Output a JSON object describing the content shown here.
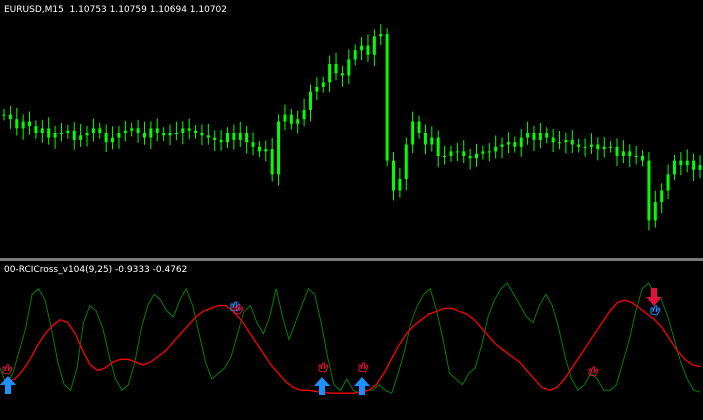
{
  "main_chart": {
    "label": "EURUSD,M15  1.10753 1.10759 1.10694 1.10702",
    "candle_color": "#00ff00"
  },
  "indicator": {
    "label": "00-RCICross_v104(9,25) -0.9333 -0.4762",
    "fast_color": "#008000",
    "slow_color": "#ff0000",
    "buy_arrow_color": "#1e90ff",
    "sell_arrow_color": "#dc143c",
    "hand_icon": "hand-signal-icon"
  },
  "chart_data": [
    {
      "type": "candlestick",
      "title": "EURUSD,M15  1.10753 1.10759 1.10694 1.10702",
      "series": [
        {
          "name": "EURUSD,M15",
          "values": [
            0.58,
            0.56,
            0.52,
            0.55,
            0.53,
            0.5,
            0.52,
            0.48,
            0.5,
            0.5,
            0.51,
            0.47,
            0.49,
            0.5,
            0.52,
            0.5,
            0.46,
            0.48,
            0.5,
            0.51,
            0.52,
            0.5,
            0.48,
            0.52,
            0.5,
            0.49,
            0.5,
            0.5,
            0.52,
            0.51,
            0.5,
            0.49,
            0.48,
            0.47,
            0.46,
            0.5,
            0.47,
            0.5,
            0.46,
            0.44,
            0.42,
            0.43,
            0.32,
            0.55,
            0.58,
            0.54,
            0.56,
            0.6,
            0.68,
            0.7,
            0.72,
            0.8,
            0.76,
            0.75,
            0.82,
            0.86,
            0.88,
            0.84,
            0.92,
            0.93,
            0.38,
            0.25,
            0.3,
            0.45,
            0.55,
            0.5,
            0.45,
            0.48,
            0.4,
            0.4,
            0.42,
            0.42,
            0.4,
            0.39,
            0.41,
            0.42,
            0.42,
            0.44,
            0.45,
            0.46,
            0.44,
            0.48,
            0.5,
            0.47,
            0.5,
            0.48,
            0.46,
            0.46,
            0.47,
            0.45,
            0.44,
            0.44,
            0.45,
            0.43,
            0.44,
            0.44,
            0.4,
            0.42,
            0.4,
            0.4,
            0.38,
            0.12,
            0.2,
            0.25,
            0.32,
            0.38,
            0.36,
            0.38,
            0.34,
            0.36
          ]
        }
      ]
    },
    {
      "type": "line",
      "title": "00-RCICross_v104(9,25) -0.9333 -0.4762",
      "series": [
        {
          "name": "RCI 9",
          "values": [
            -0.5,
            -0.8,
            -0.6,
            -0.2,
            0.2,
            0.8,
            0.9,
            0.7,
            0.2,
            -0.4,
            -0.8,
            -0.9,
            -0.5,
            0.3,
            0.6,
            0.5,
            0.2,
            -0.3,
            -0.7,
            -0.9,
            -0.8,
            -0.4,
            0.2,
            0.6,
            0.8,
            0.7,
            0.5,
            0.4,
            0.7,
            0.9,
            0.6,
            0.1,
            -0.4,
            -0.7,
            -0.6,
            -0.5,
            -0.3,
            0.1,
            0.5,
            0.6,
            0.3,
            0.1,
            0.4,
            0.9,
            0.4,
            0.0,
            0.3,
            0.6,
            0.9,
            0.8,
            0.3,
            -0.3,
            -0.8,
            -0.9,
            -0.7,
            -0.9,
            -0.95,
            -0.9,
            -0.9,
            -0.8,
            -0.9,
            -0.95,
            -0.6,
            -0.2,
            0.3,
            0.6,
            0.8,
            0.9,
            0.5,
            0.0,
            -0.6,
            -0.7,
            -0.8,
            -0.6,
            -0.5,
            -0.1,
            0.4,
            0.7,
            0.9,
            1.0,
            0.8,
            0.6,
            0.4,
            0.3,
            0.6,
            0.8,
            0.6,
            0.2,
            -0.3,
            -0.7,
            -0.9,
            -0.8,
            -0.6,
            -0.7,
            -0.9,
            -0.9,
            -0.8,
            -0.4,
            0.0,
            0.5,
            0.9,
            1.0,
            0.8,
            0.7,
            0.4,
            0.0,
            -0.4,
            -0.7,
            -0.9,
            -0.93
          ]
        },
        {
          "name": "RCI 25",
          "values": [
            -0.8,
            -0.75,
            -0.7,
            -0.55,
            -0.35,
            -0.1,
            0.1,
            0.25,
            0.35,
            0.3,
            0.1,
            -0.2,
            -0.45,
            -0.55,
            -0.5,
            -0.4,
            -0.35,
            -0.35,
            -0.4,
            -0.45,
            -0.4,
            -0.3,
            -0.2,
            -0.05,
            0.1,
            0.25,
            0.4,
            0.5,
            0.55,
            0.6,
            0.6,
            0.5,
            0.35,
            0.15,
            -0.05,
            -0.25,
            -0.45,
            -0.6,
            -0.75,
            -0.85,
            -0.9,
            -0.9,
            -0.92,
            -0.94,
            -0.95,
            -0.95,
            -0.95,
            -0.95,
            -0.93,
            -0.9,
            -0.8,
            -0.6,
            -0.35,
            -0.1,
            0.1,
            0.25,
            0.35,
            0.45,
            0.5,
            0.55,
            0.55,
            0.5,
            0.45,
            0.35,
            0.2,
            0.05,
            -0.1,
            -0.2,
            -0.3,
            -0.4,
            -0.55,
            -0.7,
            -0.85,
            -0.9,
            -0.85,
            -0.7,
            -0.5,
            -0.3,
            -0.1,
            0.1,
            0.3,
            0.5,
            0.65,
            0.7,
            0.65,
            0.55,
            0.45,
            0.35,
            0.2,
            0.0,
            -0.2,
            -0.35,
            -0.45,
            -0.48
          ]
        }
      ]
    }
  ]
}
